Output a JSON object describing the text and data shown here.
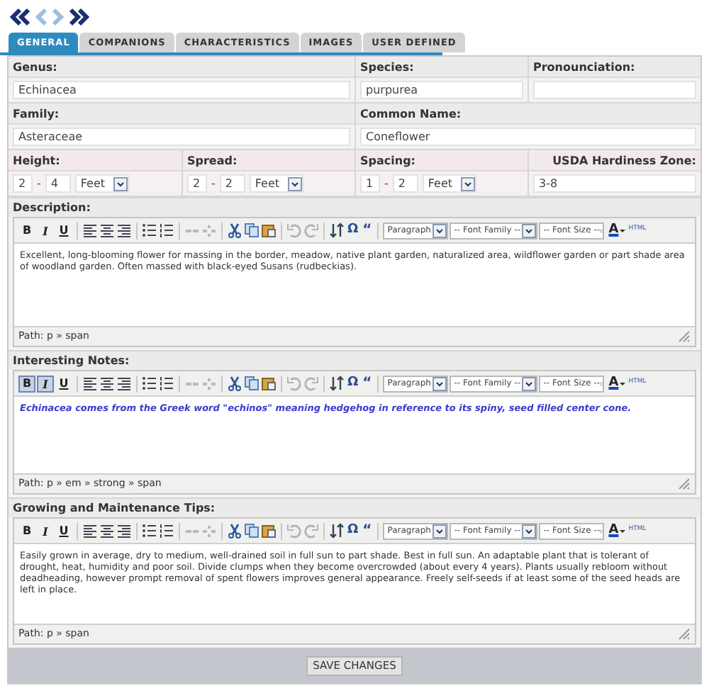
{
  "nav": [
    {
      "kind": "first",
      "disabled": false
    },
    {
      "kind": "prev",
      "disabled": true
    },
    {
      "kind": "next",
      "disabled": true
    },
    {
      "kind": "last",
      "disabled": false
    }
  ],
  "tabs": [
    {
      "label": "GENERAL",
      "selected": true
    },
    {
      "label": "COMPANIONS",
      "selected": false
    },
    {
      "label": "CHARACTERISTICS",
      "selected": false
    },
    {
      "label": "IMAGES",
      "selected": false
    },
    {
      "label": "USER DEFINED",
      "selected": false
    }
  ],
  "rows": [
    {
      "cells": [
        {
          "kind": "text",
          "label": "Genus:",
          "value": "Echinacea"
        },
        {
          "kind": "text",
          "label": "Species:",
          "value": "purpurea"
        },
        {
          "kind": "text",
          "label": "Pronounciation:"
        }
      ]
    },
    {
      "cells": [
        {
          "kind": "text",
          "label": "Family:",
          "value": "Asteraceae"
        },
        {
          "kind": "text",
          "label": "Common Name:",
          "value": "Coneflower"
        }
      ]
    },
    {
      "cells": [
        {
          "kind": "range",
          "label": "Height:",
          "from": "2",
          "to": "4",
          "unit": "Feet"
        },
        {
          "kind": "range",
          "label": "Spread:",
          "from": "2",
          "to": "2",
          "unit": "Feet"
        },
        {
          "kind": "range",
          "label": "Spacing:",
          "from": "1",
          "to": "2",
          "unit": "Feet"
        },
        {
          "kind": "text",
          "label": "USDA Hardiness Zone:",
          "value": "3-8"
        }
      ]
    }
  ],
  "range_separator": "-",
  "editors": [
    {
      "label": "Description:",
      "style_buttons": [
        {
          "label": "B",
          "selected": false
        },
        {
          "label": "I",
          "selected": false
        },
        {
          "label": "U",
          "selected": false
        }
      ],
      "toolbar": {
        "charmap": "Ω",
        "quote": "“",
        "format": "Paragraph",
        "font_family": "-- Font Family --",
        "font_size": "-- Font Size --",
        "font_color": "A",
        "html": "HTML",
        "link_disabled": true,
        "history_disabled": true
      },
      "content": "Excellent, long-blooming flower for massing in the border, meadow, native plant garden, naturalized area, wildflower garden or part shade area of woodland garden. Often massed with black-eyed Susans (rudbeckias).",
      "bold": false,
      "italic": false,
      "color": "#333333",
      "path": "Path: p » span"
    },
    {
      "label": "Interesting Notes:",
      "style_buttons": [
        {
          "label": "B",
          "selected": true
        },
        {
          "label": "I",
          "selected": true
        },
        {
          "label": "U",
          "selected": false
        }
      ],
      "toolbar": {
        "charmap": "Ω",
        "quote": "“",
        "format": "Paragraph",
        "font_family": "-- Font Family --",
        "font_size": "-- Font Size --",
        "font_color": "A",
        "html": "HTML",
        "link_disabled": true,
        "history_disabled": true
      },
      "content": "Echinacea comes from the Greek word \"echinos\" meaning hedgehog in reference to its spiny, seed filled center cone.",
      "bold": true,
      "italic": true,
      "color": "#3a3ad0",
      "path": "Path: p » em » strong » span"
    },
    {
      "label": "Growing and Maintenance Tips:",
      "style_buttons": [
        {
          "label": "B",
          "selected": false
        },
        {
          "label": "I",
          "selected": false
        },
        {
          "label": "U",
          "selected": false
        }
      ],
      "toolbar": {
        "charmap": "Ω",
        "quote": "“",
        "format": "Paragraph",
        "font_family": "-- Font Family --",
        "font_size": "-- Font Size --",
        "font_color": "A",
        "html": "HTML",
        "link_disabled": true,
        "history_disabled": true
      },
      "content": "Easily grown in average, dry to medium, well-drained soil in full sun to part shade. Best in full sun. An adaptable plant that is tolerant of drought, heat, humidity and poor soil. Divide clumps when they become overcrowded (about every 4 years). Plants usually rebloom without deadheading, however prompt removal of spent flowers improves general appearance. Freely self-seeds if at least some of the seed heads are left in place.",
      "bold": false,
      "italic": false,
      "color": "#333333",
      "path": "Path: p » span"
    }
  ],
  "save_button": "SAVE CHANGES"
}
